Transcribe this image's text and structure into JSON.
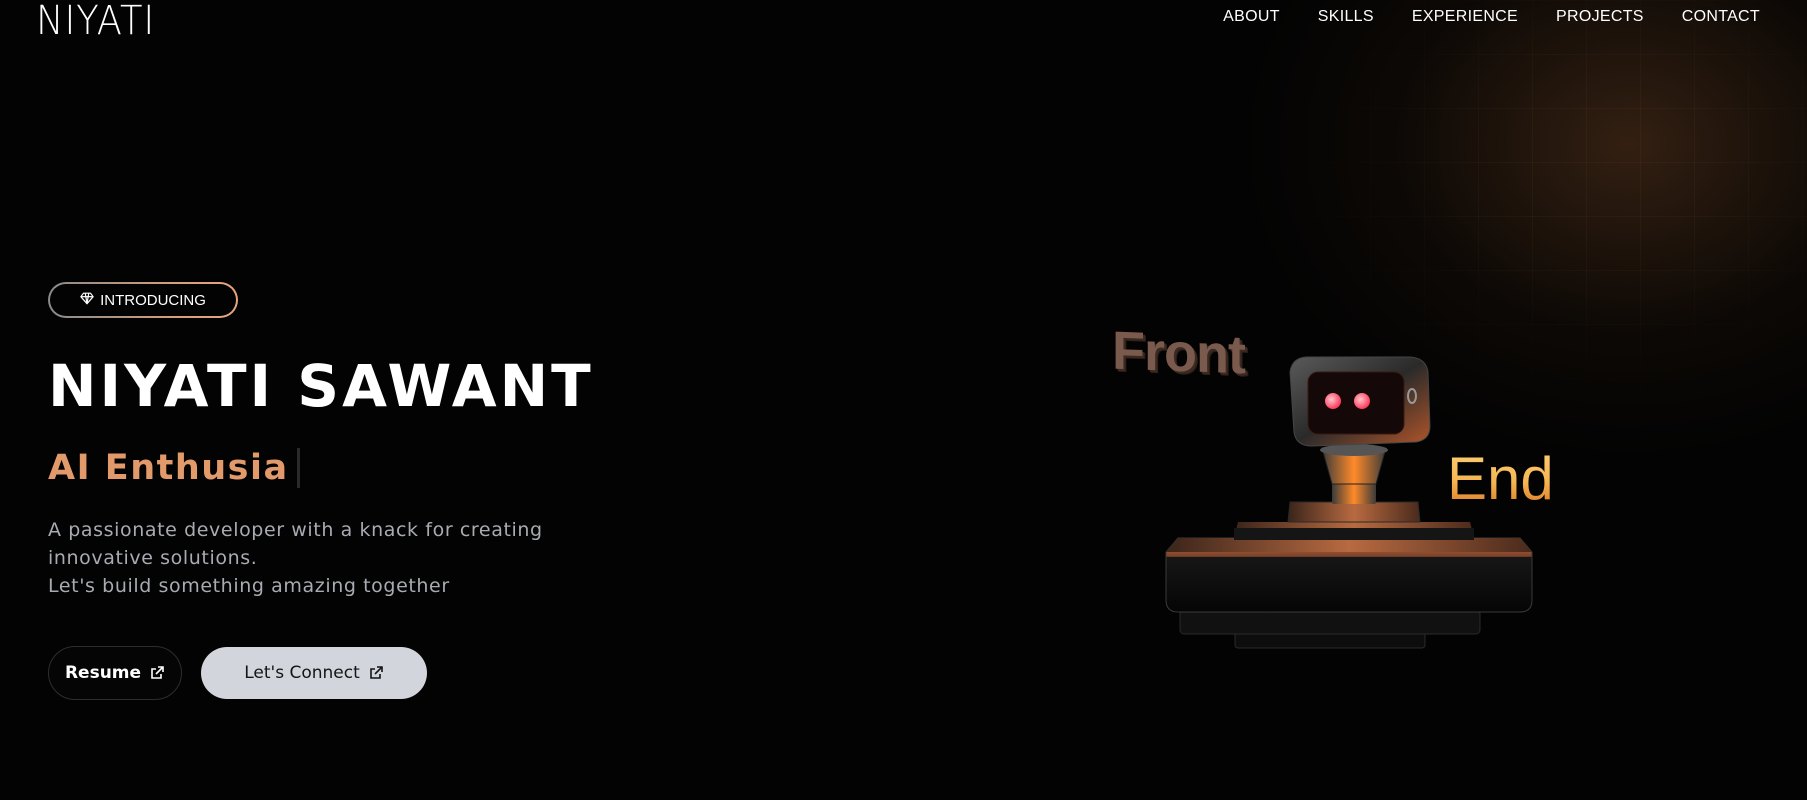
{
  "header": {
    "logo": "NIYATI",
    "nav": [
      "ABOUT",
      "SKILLS",
      "EXPERIENCE",
      "PROJECTS",
      "CONTACT"
    ]
  },
  "hero": {
    "badge": "INTRODUCING",
    "badge_icon": "gem-icon",
    "name": "NIYATI SAWANT",
    "role_typed": "AI Enthusia",
    "description_lines": [
      "A passionate developer with a knack for creating",
      "innovative solutions.",
      "Let's build something amazing together"
    ],
    "buttons": {
      "resume": "Resume",
      "connect": "Let's Connect",
      "icon": "external-link-icon"
    }
  },
  "scene": {
    "word_left": "Front",
    "word_right": "End",
    "object": "robot-3d-illustration"
  },
  "colors": {
    "background": "#030303",
    "accent": "#e39a6b",
    "muted_text": "#a8abb1",
    "connect_button": "#d2d5db"
  }
}
